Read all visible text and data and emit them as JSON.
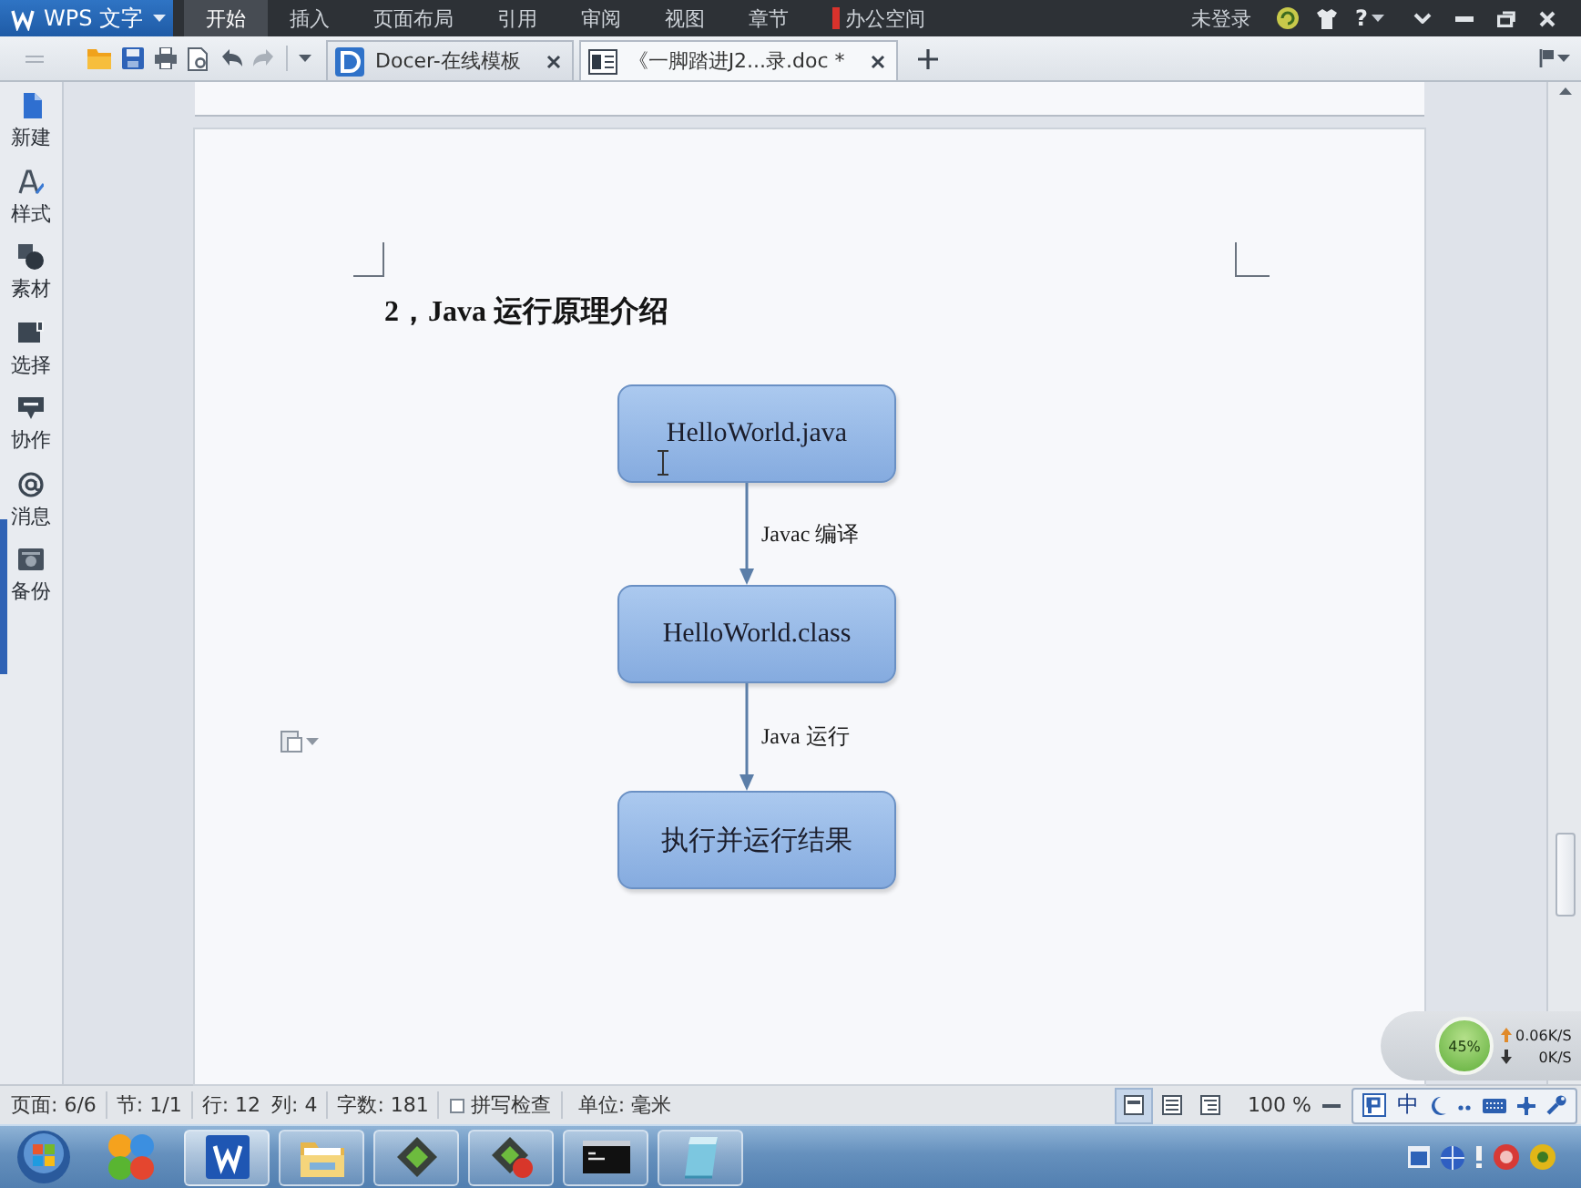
{
  "title_bar": {
    "app_button": "WPS 文字",
    "menu_tabs": [
      {
        "label": "开始",
        "kind": "tab",
        "selected": true
      },
      {
        "label": "插入",
        "kind": "tab",
        "selected": false
      },
      {
        "label": "页面布局",
        "kind": "tab",
        "selected": false
      },
      {
        "label": "引用",
        "kind": "tab",
        "selected": false
      },
      {
        "label": "审阅",
        "kind": "tab",
        "selected": false
      },
      {
        "label": "视图",
        "kind": "tab",
        "selected": false
      },
      {
        "label": "章节",
        "kind": "tab",
        "selected": false
      },
      {
        "label": "办公空间",
        "kind": "space",
        "selected": false
      }
    ],
    "account": "未登录",
    "help": "?"
  },
  "tab_bar": {
    "tabs": [
      {
        "kind": "template",
        "title": "Docer-在线模板",
        "selected": false
      },
      {
        "kind": "document",
        "title": "《一脚踏进J2...录.doc *",
        "selected": true
      }
    ]
  },
  "sidebar": {
    "items": [
      {
        "kind": "new",
        "label": "新建"
      },
      {
        "kind": "style",
        "label": "样式"
      },
      {
        "kind": "material",
        "label": "素材"
      },
      {
        "kind": "select",
        "label": "选择"
      },
      {
        "kind": "collab",
        "label": "协作"
      },
      {
        "kind": "message",
        "label": "消息"
      },
      {
        "kind": "backup",
        "label": "备份"
      }
    ]
  },
  "document": {
    "heading": "2，Java 运行原理介绍",
    "flowchart": {
      "nodes": [
        {
          "label": "HelloWorld.java"
        },
        {
          "label": "HelloWorld.class"
        },
        {
          "label": "执行并运行结果"
        }
      ],
      "edges": [
        {
          "label": "Javac 编译"
        },
        {
          "label": "Java 运行"
        }
      ]
    }
  },
  "network_monitor": {
    "gauge": "45%",
    "upload": "0.06K/S",
    "download": "0K/S"
  },
  "status_bar": {
    "groups": [
      {
        "fields": [
          "页面: 6/6"
        ]
      },
      {
        "fields": [
          "节: 1/1"
        ]
      },
      {
        "fields": [
          "行: 12",
          "列: 4"
        ]
      },
      {
        "fields": [
          "字数: 181"
        ]
      }
    ],
    "spell_check": {
      "label": "拼写检查",
      "checked": false
    },
    "unit": "单位: 毫米",
    "view_modes": [
      {
        "selected": true
      },
      {
        "selected": false
      },
      {
        "selected": false
      }
    ],
    "zoom": "100 %"
  },
  "ime": {
    "mode": "中"
  }
}
